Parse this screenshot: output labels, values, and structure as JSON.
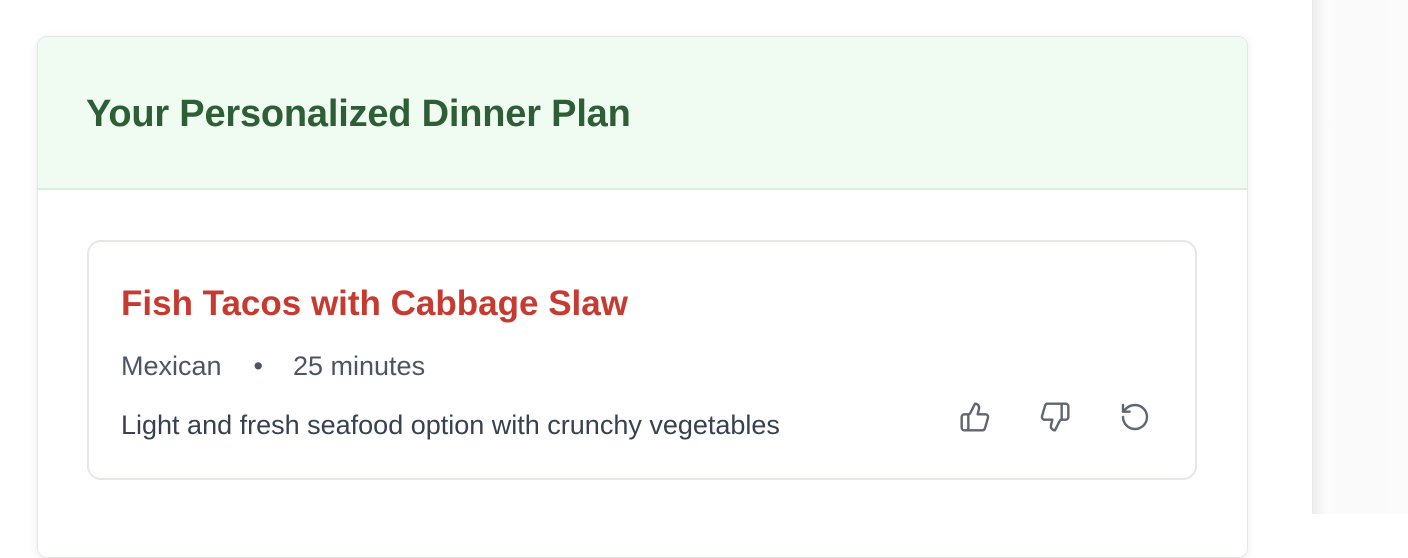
{
  "plan": {
    "title": "Your Personalized Dinner Plan"
  },
  "meal": {
    "name": "Fish Tacos with Cabbage Slaw",
    "cuisine": "Mexican",
    "separator": "•",
    "time": "25 minutes",
    "description": "Light and fresh seafood option with crunchy vegetables"
  },
  "actions": [
    {
      "name": "like",
      "icon": "thumbs-up-icon"
    },
    {
      "name": "dislike",
      "icon": "thumbs-down-icon"
    },
    {
      "name": "regenerate",
      "icon": "refresh-icon"
    }
  ],
  "colors": {
    "header_bg": "#f0fbf2",
    "title": "#2e5e35",
    "meal_name": "#c73a30",
    "meta_text": "#4b5563",
    "icon": "#5f6672"
  }
}
